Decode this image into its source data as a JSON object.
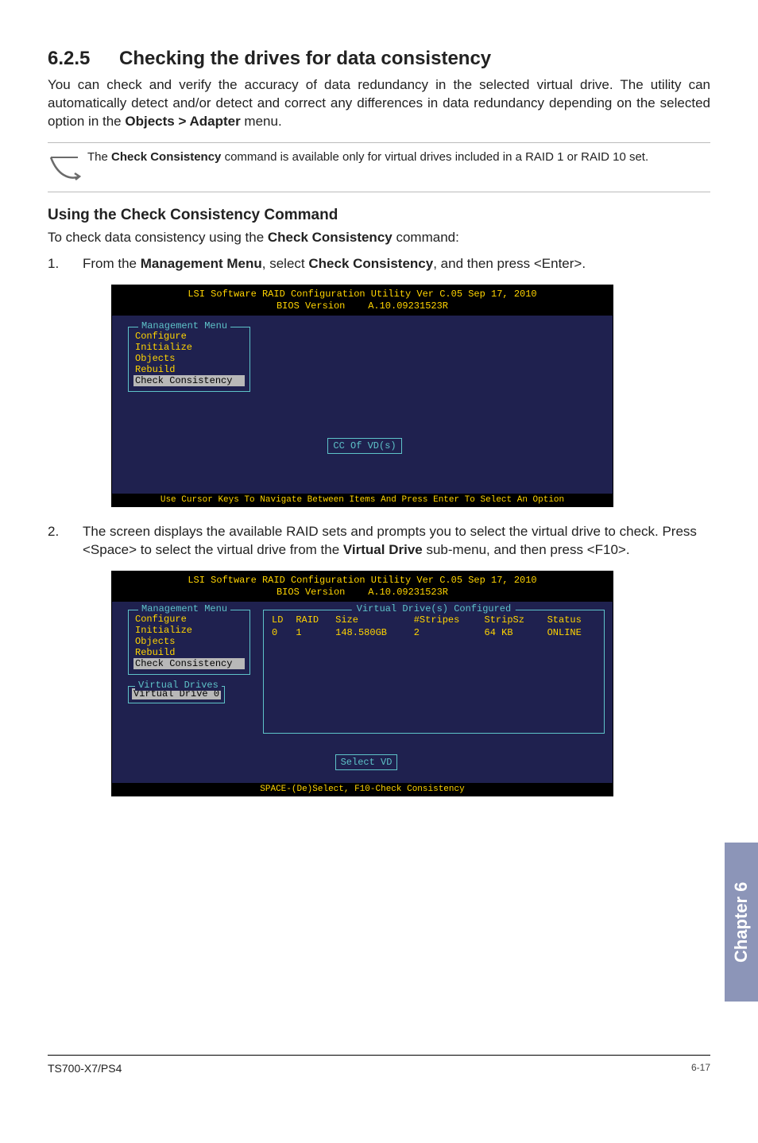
{
  "section": {
    "number": "6.2.5",
    "title": "Checking the drives for data consistency"
  },
  "intro": "You can check and verify the accuracy of data redundancy in the selected virtual drive. The utility can automatically detect and/or detect and correct any differences in data redundancy depending on the selected option in the ",
  "intro_bold": "Objects > Adapter",
  "intro_tail": " menu.",
  "note_pre": "The ",
  "note_bold": "Check Consistency",
  "note_post": " command is available only for virtual drives included in a RAID 1 or RAID 10 set.",
  "subhead": "Using the Check Consistency Command",
  "subintro_pre": "To check data consistency using the ",
  "subintro_bold": "Check Consistency",
  "subintro_post": " command:",
  "step1_pre": "From the ",
  "step1_b1": "Management Menu",
  "step1_mid": ", select ",
  "step1_b2": "Check Consistency",
  "step1_post": ", and then press <Enter>.",
  "step2_pre": "The screen displays the available RAID sets and prompts you to select the virtual drive to check. Press <Space> to select the virtual drive from the ",
  "step2_b1": "Virtual Drive",
  "step2_post": " sub-menu, and then press <F10>.",
  "bios1": {
    "title_line1": "LSI Software RAID Configuration Utility Ver C.05 Sep 17, 2010",
    "title_line2": "BIOS Version    A.10.09231523R",
    "menu_title": "Management Menu",
    "menu_items": [
      "Configure",
      "Initialize",
      "Objects",
      "Rebuild",
      "Check Consistency"
    ],
    "selected_index": 4,
    "center_button": "CC Of VD(s)",
    "footer": "Use Cursor Keys To Navigate Between Items And Press Enter To Select An Option"
  },
  "bios2": {
    "title_line1": "LSI Software RAID Configuration Utility Ver C.05 Sep 17, 2010",
    "title_line2": "BIOS Version    A.10.09231523R",
    "menu_title": "Management Menu",
    "menu_items": [
      "Configure",
      "Initialize",
      "Objects",
      "Rebuild",
      "Check Consistency"
    ],
    "selected_index": 4,
    "vd_panel_title": "Virtual Drive(s) Configured",
    "columns": [
      "LD",
      "RAID",
      "Size",
      "#Stripes",
      "StripSz",
      "Status"
    ],
    "row": [
      "0",
      "1",
      "148.580GB",
      "2",
      "64 KB",
      "ONLINE"
    ],
    "virtual_box_title": "Virtual Drives",
    "virtual_item": "Virtual Drive 0",
    "center_button": "Select VD",
    "footer": "SPACE-(De)Select,    F10-Check Consistency"
  },
  "sidetab": "Chapter 6",
  "footer_left": "TS700-X7/PS4",
  "footer_right": "6-17"
}
